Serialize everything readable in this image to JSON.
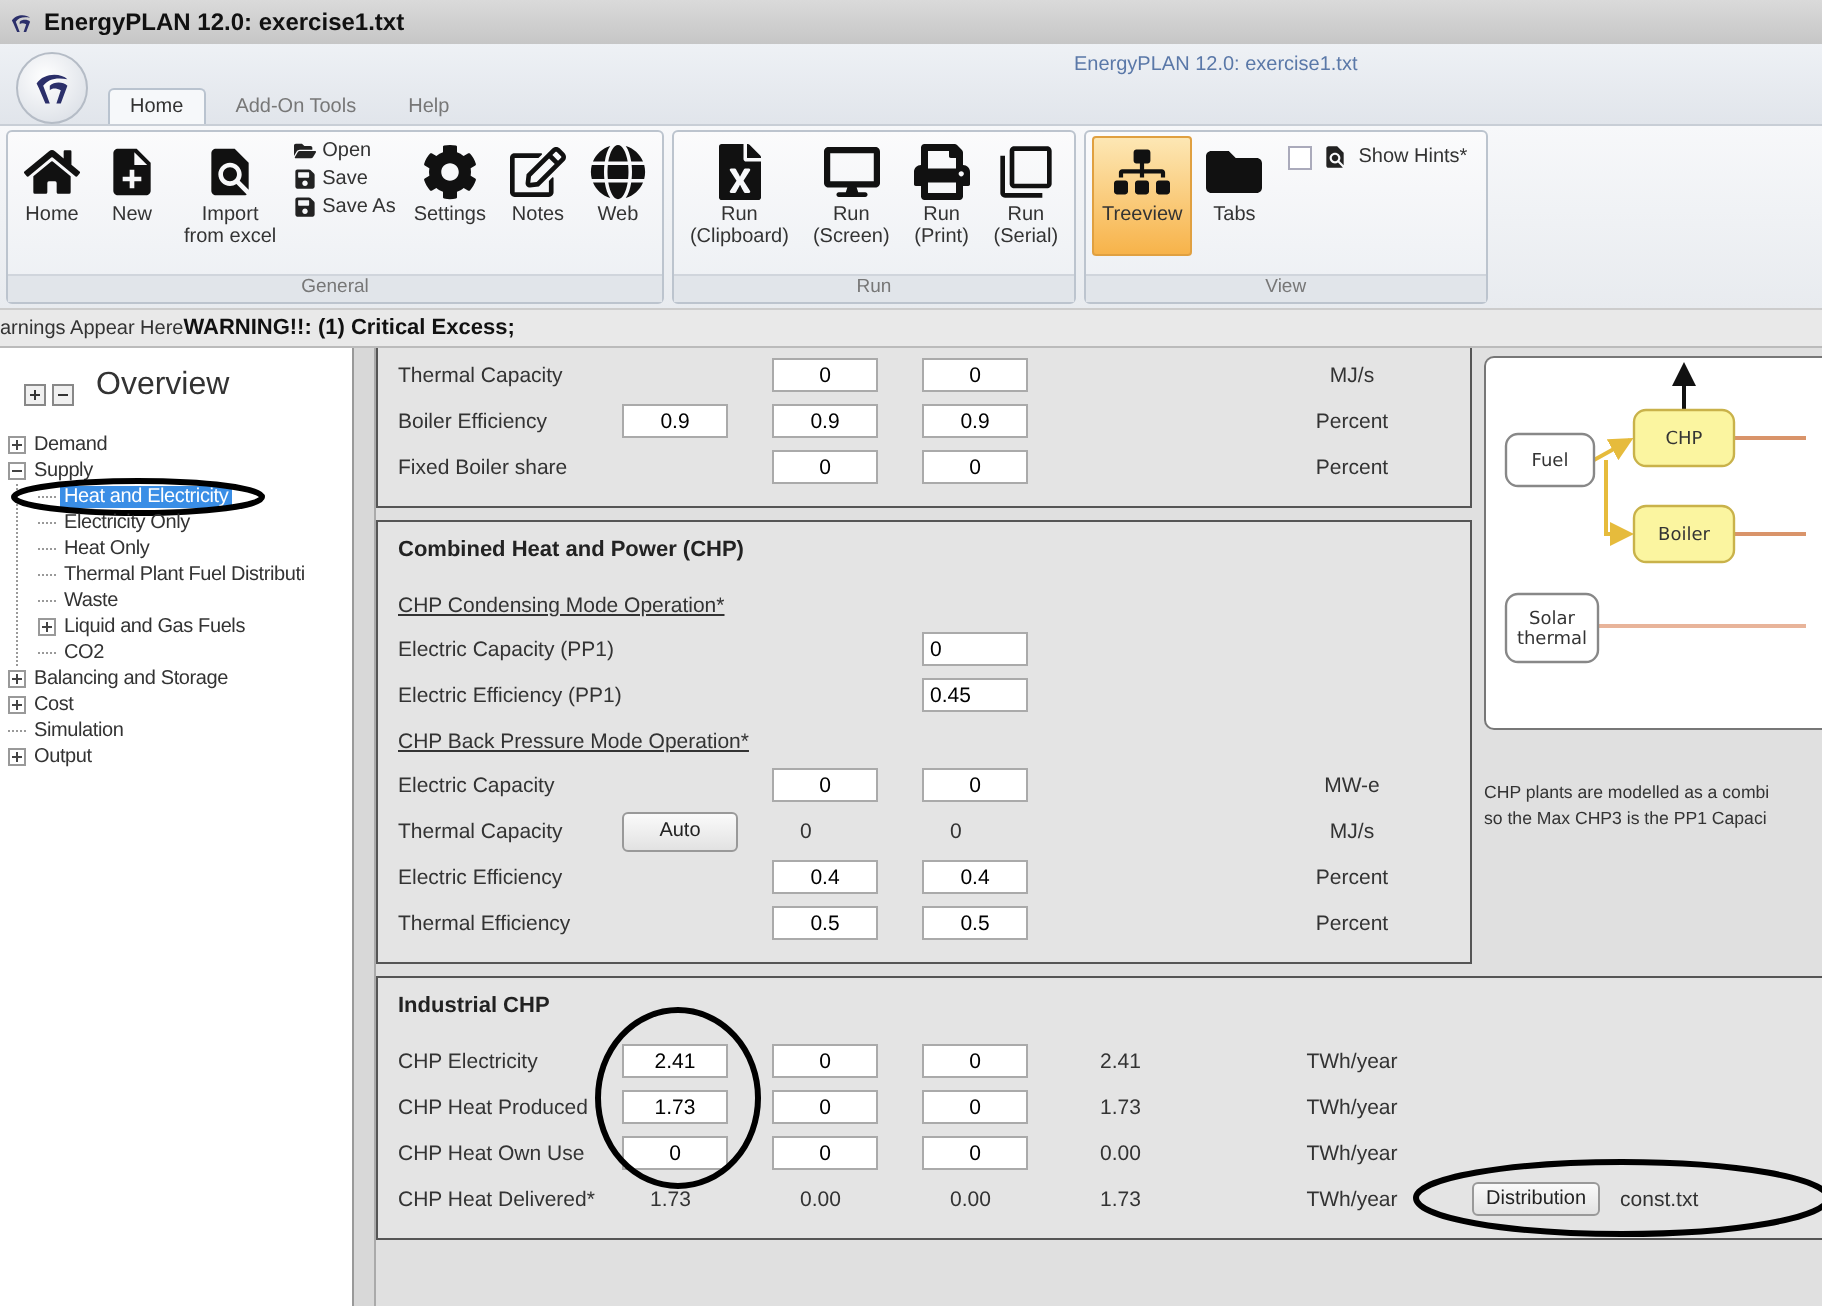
{
  "window": {
    "title": "EnergyPLAN 12.0: exercise1.txt"
  },
  "ribbon": {
    "caption": "EnergyPLAN 12.0: exercise1.txt",
    "tabs": [
      {
        "label": "Home",
        "selected": true
      },
      {
        "label": "Add-On Tools",
        "selected": false
      },
      {
        "label": "Help",
        "selected": false
      }
    ],
    "groups": [
      {
        "caption": "General",
        "items": [
          {
            "kind": "button",
            "label": "Home"
          },
          {
            "kind": "button",
            "label": "New"
          },
          {
            "kind": "button",
            "label": "Import\nfrom excel"
          },
          {
            "kind": "stack",
            "entries": [
              "Open",
              "Save",
              "Save As"
            ]
          },
          {
            "kind": "button",
            "label": "Settings"
          },
          {
            "kind": "button",
            "label": "Notes"
          },
          {
            "kind": "button",
            "label": "Web"
          }
        ]
      },
      {
        "caption": "Run",
        "items": [
          {
            "kind": "button",
            "label": "Run\n(Clipboard)"
          },
          {
            "kind": "button",
            "label": "Run\n(Screen)"
          },
          {
            "kind": "button",
            "label": "Run\n(Print)"
          },
          {
            "kind": "button",
            "label": "Run\n(Serial)"
          }
        ]
      },
      {
        "caption": "View",
        "items": [
          {
            "kind": "toggle",
            "label": "Treeview",
            "selected": true
          },
          {
            "kind": "toggle",
            "label": "Tabs",
            "selected": false
          },
          {
            "kind": "check",
            "label": "Show Hints*",
            "checked": false
          }
        ]
      }
    ]
  },
  "warning_bar": {
    "prefix": "arnings Appear Here",
    "message": "WARNING!!: (1) Critical Excess;"
  },
  "overview": {
    "title": "Overview",
    "tree": [
      {
        "label": "Demand",
        "expanded": false,
        "selected": false
      },
      {
        "label": "Supply",
        "expanded": true,
        "selected": false,
        "children": [
          {
            "label": "Heat and Electricity",
            "selected": true
          },
          {
            "label": "Electricity Only",
            "selected": false
          },
          {
            "label": "Heat Only",
            "selected": false
          },
          {
            "label": "Thermal Plant Fuel Distributi",
            "selected": false
          },
          {
            "label": "Waste",
            "selected": false
          },
          {
            "label": "Liquid and Gas Fuels",
            "expanded": false,
            "selected": false
          },
          {
            "label": "CO2",
            "selected": false
          }
        ]
      },
      {
        "label": "Balancing and Storage",
        "expanded": false,
        "selected": false
      },
      {
        "label": "Cost",
        "expanded": false,
        "selected": false
      },
      {
        "label": "Simulation",
        "selected": false
      },
      {
        "label": "Output",
        "expanded": false,
        "selected": false
      }
    ]
  },
  "boiler_section": {
    "items": [
      {
        "kind": "row",
        "label": "Thermal Capacity",
        "cells": [
          {
            "kind": "empty"
          },
          {
            "kind": "input",
            "value": "0"
          },
          {
            "kind": "input",
            "value": "0"
          }
        ],
        "unit": "MJ/s"
      },
      {
        "kind": "row",
        "label": "Boiler Efficiency",
        "cells": [
          {
            "kind": "input",
            "value": "0.9"
          },
          {
            "kind": "input",
            "value": "0.9"
          },
          {
            "kind": "input",
            "value": "0.9"
          }
        ],
        "unit": "Percent"
      },
      {
        "kind": "row",
        "label": "Fixed Boiler share",
        "cells": [
          {
            "kind": "empty"
          },
          {
            "kind": "input",
            "value": "0"
          },
          {
            "kind": "input",
            "value": "0"
          }
        ],
        "unit": "Percent"
      }
    ]
  },
  "chp_section": {
    "title": "Combined Heat and Power (CHP)",
    "items": [
      {
        "kind": "subheading",
        "label": "CHP Condensing Mode Operation*"
      },
      {
        "kind": "row",
        "label": "Electric Capacity (PP1)",
        "cells": [
          {
            "kind": "empty"
          },
          {
            "kind": "empty"
          },
          {
            "kind": "entry",
            "value": "0"
          }
        ]
      },
      {
        "kind": "row",
        "label": "Electric Efficiency (PP1)",
        "cells": [
          {
            "kind": "empty"
          },
          {
            "kind": "empty"
          },
          {
            "kind": "entry",
            "value": "0.45"
          }
        ]
      },
      {
        "kind": "subheading",
        "label": "CHP Back Pressure Mode Operation*"
      },
      {
        "kind": "row",
        "label": "Electric Capacity",
        "cells": [
          {
            "kind": "empty"
          },
          {
            "kind": "input",
            "value": "0"
          },
          {
            "kind": "input",
            "value": "0"
          }
        ],
        "unit": "MW-e"
      },
      {
        "kind": "row",
        "label": "Thermal Capacity",
        "cells": [
          {
            "kind": "button",
            "value": "Auto"
          },
          {
            "kind": "text",
            "value": "0"
          },
          {
            "kind": "text",
            "value": "0"
          }
        ],
        "unit": "MJ/s"
      },
      {
        "kind": "row",
        "label": "Electric Efficiency",
        "cells": [
          {
            "kind": "empty"
          },
          {
            "kind": "input",
            "value": "0.4"
          },
          {
            "kind": "input",
            "value": "0.4"
          }
        ],
        "unit": "Percent"
      },
      {
        "kind": "row",
        "label": "Thermal Efficiency",
        "cells": [
          {
            "kind": "empty"
          },
          {
            "kind": "input",
            "value": "0.5"
          },
          {
            "kind": "input",
            "value": "0.5"
          }
        ],
        "unit": "Percent"
      }
    ]
  },
  "diagram": {
    "nodes": [
      {
        "label": "Fuel",
        "kind": "source"
      },
      {
        "label": "CHP",
        "kind": "plant"
      },
      {
        "label": "Boiler",
        "kind": "plant"
      },
      {
        "label": "Solar thermal",
        "kind": "source"
      }
    ]
  },
  "description": [
    "CHP plants are modelled as a combi",
    "so the Max CHP3 is the PP1 Capaci"
  ],
  "industrial_section": {
    "title": "Industrial CHP",
    "items": [
      {
        "kind": "row",
        "label": "CHP Electricity",
        "cells": [
          {
            "kind": "input",
            "value": "2.41"
          },
          {
            "kind": "input",
            "value": "0"
          },
          {
            "kind": "input",
            "value": "0"
          },
          {
            "kind": "text",
            "value": "2.41"
          }
        ],
        "unit": "TWh/year"
      },
      {
        "kind": "row",
        "label": "CHP Heat Produced",
        "cells": [
          {
            "kind": "input",
            "value": "1.73"
          },
          {
            "kind": "input",
            "value": "0"
          },
          {
            "kind": "input",
            "value": "0"
          },
          {
            "kind": "text",
            "value": "1.73"
          }
        ],
        "unit": "TWh/year"
      },
      {
        "kind": "row",
        "label": "CHP Heat Own Use",
        "cells": [
          {
            "kind": "input",
            "value": "0"
          },
          {
            "kind": "input",
            "value": "0"
          },
          {
            "kind": "input",
            "value": "0"
          },
          {
            "kind": "text",
            "value": "0.00"
          }
        ],
        "unit": "TWh/year"
      },
      {
        "kind": "row",
        "label": "CHP Heat Delivered*",
        "cells": [
          {
            "kind": "text",
            "value": "1.73"
          },
          {
            "kind": "text",
            "value": "0.00"
          },
          {
            "kind": "text",
            "value": "0.00"
          },
          {
            "kind": "text",
            "value": "1.73"
          }
        ],
        "unit": "TWh/year",
        "after": [
          {
            "kind": "button",
            "value": "Distribution"
          },
          {
            "kind": "text",
            "value": "const.txt"
          }
        ]
      }
    ]
  }
}
